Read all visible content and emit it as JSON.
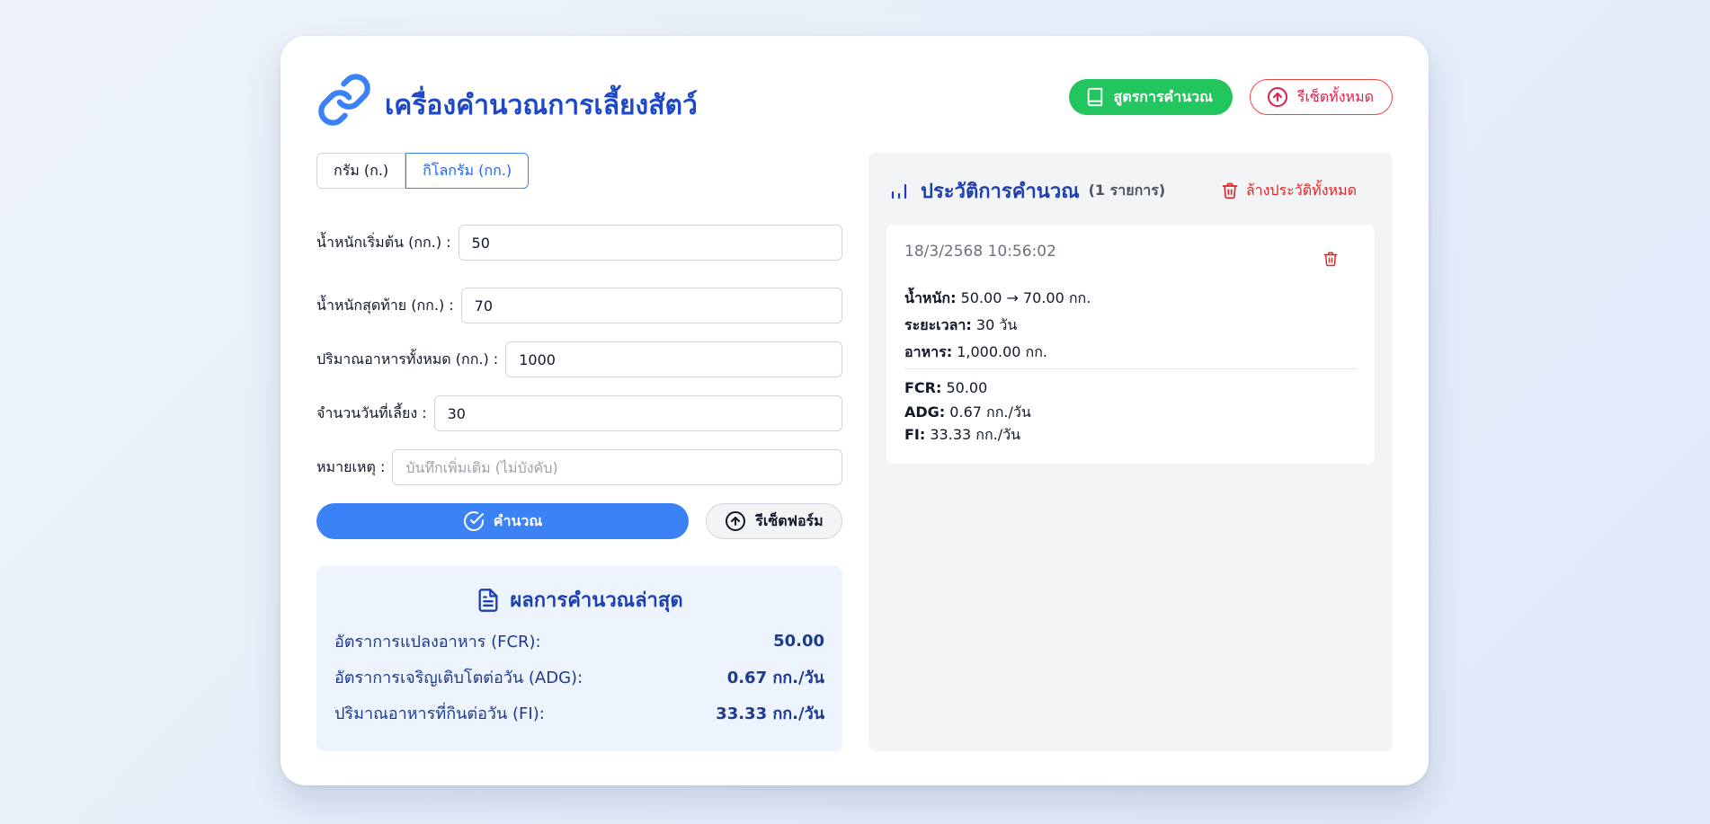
{
  "app": {
    "title": "เครื่องคำนวณการเลี้ยงสัตว์",
    "logo_icon": "link-icon"
  },
  "toolbar": {
    "formula_label": "สูตรการคำนวณ",
    "formula_icon": "book-icon",
    "reset_all_label": "รีเซ็ตทั้งหมด",
    "reset_all_icon": "arrow-up-circle-icon"
  },
  "units": {
    "gram_label": "กรัม (ก.)",
    "kilogram_label": "กิโลกรัม (กก.)",
    "selected": "kilogram"
  },
  "form": {
    "initial_weight": {
      "label": "น้ำหนักเริ่มต้น (กก.) :",
      "value": "50"
    },
    "final_weight": {
      "label": "น้ำหนักสุดท้าย (กก.) :",
      "value": "70"
    },
    "total_feed": {
      "label": "ปริมาณอาหารทั้งหมด (กก.) :",
      "value": "1000"
    },
    "days": {
      "label": "จำนวนวันที่เลี้ยง :",
      "value": "30"
    },
    "note": {
      "label": "หมายเหตุ :",
      "value": "",
      "placeholder": "บันทึกเพิ่มเติม (ไม่บังคับ)"
    }
  },
  "actions": {
    "calculate_label": "คำนวณ",
    "calculate_icon": "check-circle-icon",
    "reset_form_label": "รีเซ็ตฟอร์ม",
    "reset_form_icon": "arrow-up-circle-icon"
  },
  "result": {
    "title": "ผลการคำนวณล่าสุด",
    "icon": "document-icon",
    "rows": [
      {
        "label": "อัตราการแปลงอาหาร (FCR):",
        "value": "50.00"
      },
      {
        "label": "อัตราการเจริญเติบโตต่อวัน (ADG):",
        "value": "0.67 กก./วัน"
      },
      {
        "label": "ปริมาณอาหารที่กินต่อวัน (FI):",
        "value": "33.33 กก./วัน"
      }
    ]
  },
  "history": {
    "title": "ประวัติการคำนวณ",
    "icon": "bar-chart-icon",
    "count": "(1 รายการ)",
    "clear_label": "ล้างประวัติทั้งหมด",
    "clear_icon": "trash-icon",
    "entries": [
      {
        "timestamp": "18/3/2568 10:56:02",
        "weight_label": "น้ำหนัก:",
        "weight_value": "50.00 → 70.00 กก.",
        "duration_label": "ระยะเวลา:",
        "duration_value": "30 วัน",
        "feed_label": "อาหาร:",
        "feed_value": "1,000.00 กก.",
        "fcr_label": "FCR:",
        "fcr_value": "50.00",
        "adg_label": "ADG:",
        "adg_value": "0.67 กก./วัน",
        "fi_label": "FI:",
        "fi_value": "33.33 กก./วัน"
      }
    ]
  },
  "colors": {
    "primary": "#3b82f6",
    "title": "#1e48c7",
    "success": "#22c55e",
    "danger": "#ef4444"
  }
}
